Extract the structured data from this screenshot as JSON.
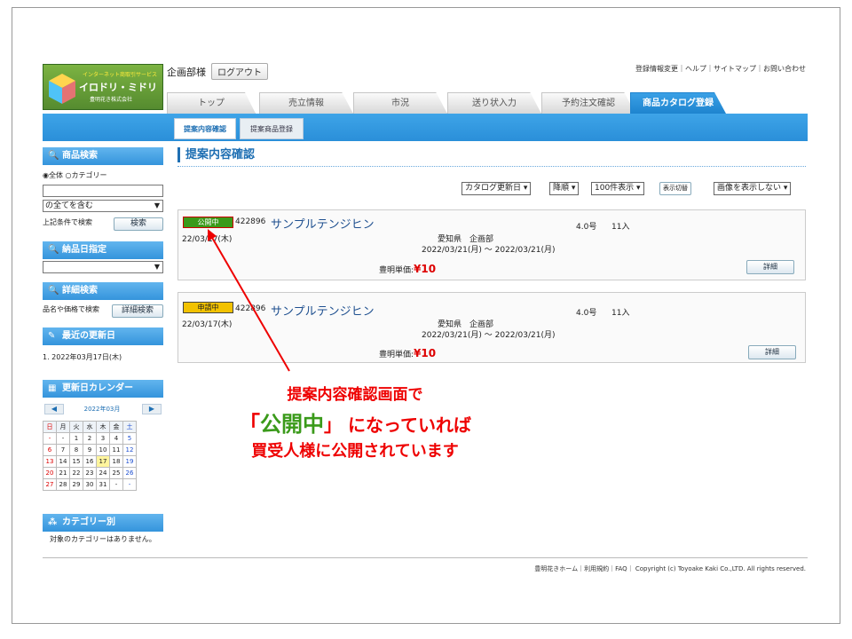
{
  "logo": {
    "line1": "インターネット商取引サービス",
    "line2": "イロドリ・ミドリ",
    "line3": "豊明花き株式会社"
  },
  "user": {
    "name": "企画部様",
    "logout": "ログアウト"
  },
  "top_links": "登録情報変更｜ヘルプ｜サイトマップ｜お問い合わせ",
  "tabs": [
    {
      "label": "トップ"
    },
    {
      "label": "売立情報"
    },
    {
      "label": "市況"
    },
    {
      "label": "送り状入力"
    },
    {
      "label": "予約注文確認"
    },
    {
      "label": "商品カタログ登録"
    }
  ],
  "subtabs": [
    {
      "label": "提案内容確認"
    },
    {
      "label": "提案商品登録"
    }
  ],
  "sidebar": {
    "product_search": {
      "title": "商品検索",
      "radio_all": "全体",
      "radio_category": "カテゴリー",
      "select": "の全てを含む",
      "note": "上記条件で検索",
      "button": "検索"
    },
    "delivery_date": {
      "title": "納品日指定"
    },
    "detail_search": {
      "title": "詳細検索",
      "note": "品名や価格で検索",
      "button": "詳細検索"
    },
    "recent_update": {
      "title": "最近の更新日",
      "item": "1. 2022年03月17日(木)"
    },
    "calendar": {
      "title": "更新日カレンダー",
      "month": "2022年03月",
      "weekdays": [
        "日",
        "月",
        "火",
        "水",
        "木",
        "金",
        "土"
      ],
      "rows": [
        [
          "-",
          "-",
          "1",
          "2",
          "3",
          "4",
          "5"
        ],
        [
          "6",
          "7",
          "8",
          "9",
          "10",
          "11",
          "12"
        ],
        [
          "13",
          "14",
          "15",
          "16",
          "17",
          "18",
          "19"
        ],
        [
          "20",
          "21",
          "22",
          "23",
          "24",
          "25",
          "26"
        ],
        [
          "27",
          "28",
          "29",
          "30",
          "31",
          "-",
          "-"
        ]
      ]
    },
    "category": {
      "title": "カテゴリー別",
      "note": "対象のカテゴリーはありません。"
    }
  },
  "main": {
    "title": "提案内容確認",
    "controls": {
      "sort_field": "カタログ更新日",
      "order": "降順",
      "per_page": "100件表示",
      "switch": "表示切替",
      "image": "画像を表示しない"
    },
    "items": [
      {
        "status": "公開中",
        "code": "422896",
        "name": "サンプルテンジヒン",
        "date": "22/03/17(木)",
        "size": "4.0号",
        "qty": "11入",
        "area": "愛知県　企画部",
        "period": "2022/03/21(月) ～ 2022/03/21(月)",
        "price_label": "豊明単価:",
        "price": "¥10",
        "detail": "詳細"
      },
      {
        "status": "申請中",
        "code": "422896",
        "name": "サンプルテンジヒン",
        "date": "22/03/17(木)",
        "size": "4.0号",
        "qty": "11入",
        "area": "愛知県　企画部",
        "period": "2022/03/21(月) ～ 2022/03/21(月)",
        "price_label": "豊明単価:",
        "price": "¥10",
        "detail": "詳細"
      }
    ]
  },
  "annotation": {
    "line1": "提案内容確認画面で",
    "line2_a": "「",
    "line2_b": "公開中",
    "line2_c": "」 になっていれば",
    "line3": "買受人様に公開されています"
  },
  "footer": "豊明花きホーム｜利用規約｜FAQ｜ Copyright (c) Toyoake Kaki Co.,LTD. All rights reserved.",
  "colors": {
    "accent": "#1e84cf",
    "public_badge": "#3a9a1a",
    "pending_badge": "#f2c200",
    "annotation": "#e00000"
  }
}
